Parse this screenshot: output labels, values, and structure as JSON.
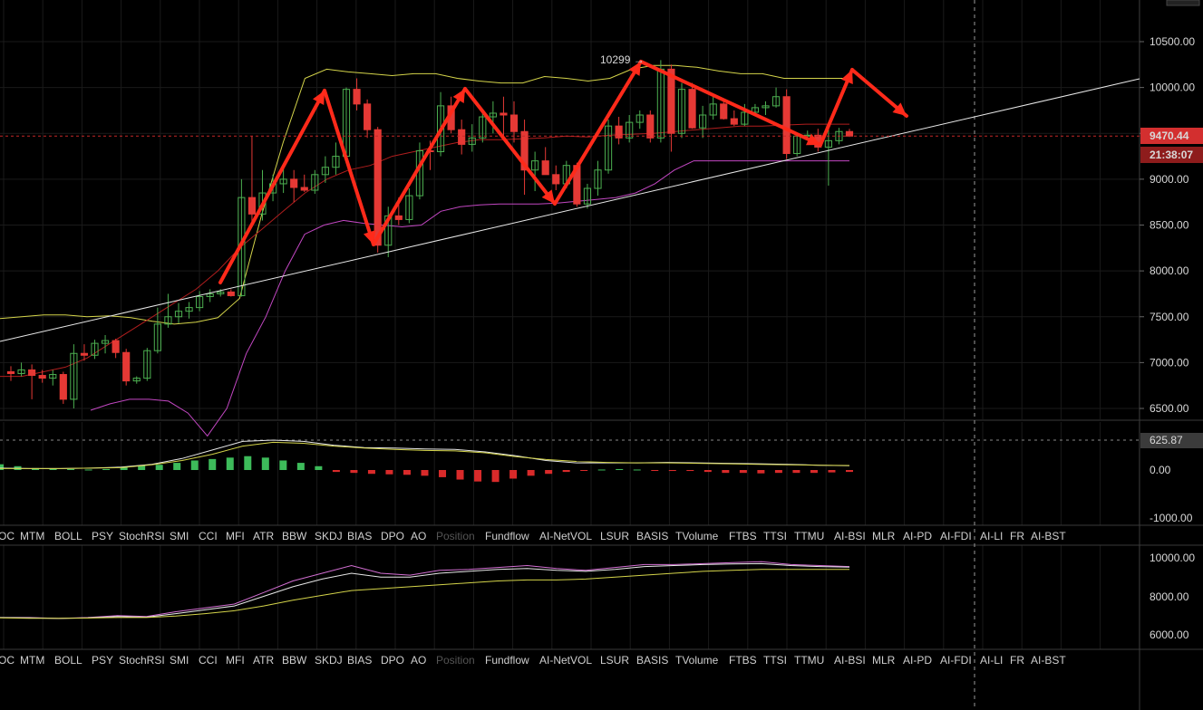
{
  "price_panel": {
    "y_ticks": [
      "10500.00",
      "10000.00",
      "9500.00",
      "9000.00",
      "8500.00",
      "8000.00",
      "7500.00",
      "7000.00",
      "6500.00"
    ],
    "price_label": "9470.44",
    "countdown_label": "21:38:07",
    "high_annotation": "10299",
    "price_tag_color": "#d32f2f",
    "up_candle_color": "#4caf50",
    "down_candle_color": "#e53935"
  },
  "macd_panel": {
    "y_ticks": [
      "625.87",
      "0.00",
      "-1000.00"
    ]
  },
  "lower_panel": {
    "y_ticks": [
      "10000.00",
      "8000.00",
      "6000.00"
    ]
  },
  "indicator_tabs": [
    {
      "label": "OC",
      "active": true
    },
    {
      "label": "MTM",
      "active": true
    },
    {
      "label": "BOLL",
      "active": true
    },
    {
      "label": "PSY",
      "active": true
    },
    {
      "label": "StochRSI",
      "active": true
    },
    {
      "label": "SMI",
      "active": true
    },
    {
      "label": "CCI",
      "active": true
    },
    {
      "label": "MFI",
      "active": true
    },
    {
      "label": "ATR",
      "active": true
    },
    {
      "label": "BBW",
      "active": true
    },
    {
      "label": "SKDJ",
      "active": true
    },
    {
      "label": "BIAS",
      "active": true
    },
    {
      "label": "DPO",
      "active": true
    },
    {
      "label": "AO",
      "active": true
    },
    {
      "label": "Position",
      "active": false
    },
    {
      "label": "Fundflow",
      "active": true
    },
    {
      "label": "AI-NetVOL",
      "active": true
    },
    {
      "label": "LSUR",
      "active": true
    },
    {
      "label": "BASIS",
      "active": true
    },
    {
      "label": "TVolume",
      "active": true
    },
    {
      "label": "FTBS",
      "active": true
    },
    {
      "label": "TTSI",
      "active": true
    },
    {
      "label": "TTMU",
      "active": true
    },
    {
      "label": "AI-BSI",
      "active": true
    },
    {
      "label": "MLR",
      "active": true
    },
    {
      "label": "AI-PD",
      "active": true
    },
    {
      "label": "AI-FDI",
      "active": true
    },
    {
      "label": "AI-LI",
      "active": true
    },
    {
      "label": "FR",
      "active": true
    },
    {
      "label": "AI-BST",
      "active": true
    }
  ],
  "chart_data": {
    "type": "candlestick",
    "title": "",
    "ylim": [
      6400,
      10800
    ],
    "current_price": 9470.44,
    "candles": [
      {
        "o": 6900,
        "h": 6960,
        "l": 6800,
        "c": 6880
      },
      {
        "o": 6880,
        "h": 7000,
        "l": 6850,
        "c": 6920
      },
      {
        "o": 6920,
        "h": 6980,
        "l": 6600,
        "c": 6860
      },
      {
        "o": 6860,
        "h": 6920,
        "l": 6780,
        "c": 6830
      },
      {
        "o": 6830,
        "h": 6920,
        "l": 6750,
        "c": 6870
      },
      {
        "o": 6870,
        "h": 6900,
        "l": 6550,
        "c": 6600
      },
      {
        "o": 6600,
        "h": 7200,
        "l": 6500,
        "c": 7100
      },
      {
        "o": 7100,
        "h": 7200,
        "l": 7020,
        "c": 7080
      },
      {
        "o": 7080,
        "h": 7250,
        "l": 7040,
        "c": 7210
      },
      {
        "o": 7210,
        "h": 7300,
        "l": 7100,
        "c": 7240
      },
      {
        "o": 7240,
        "h": 7260,
        "l": 7050,
        "c": 7110
      },
      {
        "o": 7110,
        "h": 7150,
        "l": 6750,
        "c": 6800
      },
      {
        "o": 6800,
        "h": 6850,
        "l": 6770,
        "c": 6830
      },
      {
        "o": 6830,
        "h": 7160,
        "l": 6800,
        "c": 7130
      },
      {
        "o": 7130,
        "h": 7600,
        "l": 7100,
        "c": 7420
      },
      {
        "o": 7420,
        "h": 7750,
        "l": 7380,
        "c": 7500
      },
      {
        "o": 7500,
        "h": 7650,
        "l": 7430,
        "c": 7560
      },
      {
        "o": 7560,
        "h": 7660,
        "l": 7480,
        "c": 7600
      },
      {
        "o": 7600,
        "h": 7780,
        "l": 7560,
        "c": 7720
      },
      {
        "o": 7720,
        "h": 7800,
        "l": 7660,
        "c": 7750
      },
      {
        "o": 7750,
        "h": 7800,
        "l": 7720,
        "c": 7770
      },
      {
        "o": 7770,
        "h": 7800,
        "l": 7720,
        "c": 7730
      },
      {
        "o": 7730,
        "h": 9000,
        "l": 7720,
        "c": 8800
      },
      {
        "o": 8800,
        "h": 9470,
        "l": 8500,
        "c": 8620
      },
      {
        "o": 8620,
        "h": 9100,
        "l": 8550,
        "c": 8850
      },
      {
        "o": 8850,
        "h": 9050,
        "l": 8760,
        "c": 8950
      },
      {
        "o": 8950,
        "h": 9150,
        "l": 8850,
        "c": 9000
      },
      {
        "o": 9000,
        "h": 9100,
        "l": 8750,
        "c": 8910
      },
      {
        "o": 8910,
        "h": 9050,
        "l": 8860,
        "c": 8880
      },
      {
        "o": 8880,
        "h": 9100,
        "l": 8840,
        "c": 9050
      },
      {
        "o": 9050,
        "h": 9250,
        "l": 8960,
        "c": 9130
      },
      {
        "o": 9130,
        "h": 9400,
        "l": 9050,
        "c": 9250
      },
      {
        "o": 9250,
        "h": 10000,
        "l": 9200,
        "c": 9980
      },
      {
        "o": 9980,
        "h": 10100,
        "l": 9750,
        "c": 9820
      },
      {
        "o": 9820,
        "h": 9870,
        "l": 9450,
        "c": 9540
      },
      {
        "o": 9540,
        "h": 9570,
        "l": 8200,
        "c": 8280
      },
      {
        "o": 8280,
        "h": 8700,
        "l": 8150,
        "c": 8600
      },
      {
        "o": 8600,
        "h": 8800,
        "l": 8500,
        "c": 8560
      },
      {
        "o": 8560,
        "h": 8900,
        "l": 8520,
        "c": 8820
      },
      {
        "o": 8820,
        "h": 9400,
        "l": 8780,
        "c": 9310
      },
      {
        "o": 9310,
        "h": 9420,
        "l": 9100,
        "c": 9300
      },
      {
        "o": 9300,
        "h": 9950,
        "l": 9250,
        "c": 9800
      },
      {
        "o": 9800,
        "h": 9900,
        "l": 9500,
        "c": 9540
      },
      {
        "o": 9540,
        "h": 9650,
        "l": 9270,
        "c": 9380
      },
      {
        "o": 9380,
        "h": 9600,
        "l": 9300,
        "c": 9450
      },
      {
        "o": 9450,
        "h": 9750,
        "l": 9400,
        "c": 9680
      },
      {
        "o": 9680,
        "h": 9850,
        "l": 9500,
        "c": 9720
      },
      {
        "o": 9720,
        "h": 9900,
        "l": 9450,
        "c": 9700
      },
      {
        "o": 9700,
        "h": 9850,
        "l": 9400,
        "c": 9520
      },
      {
        "o": 9520,
        "h": 9650,
        "l": 8830,
        "c": 9100
      },
      {
        "o": 9100,
        "h": 9300,
        "l": 8870,
        "c": 9200
      },
      {
        "o": 9200,
        "h": 9350,
        "l": 9050,
        "c": 9050
      },
      {
        "o": 9050,
        "h": 9150,
        "l": 8880,
        "c": 8950
      },
      {
        "o": 8950,
        "h": 9200,
        "l": 8900,
        "c": 9150
      },
      {
        "o": 9150,
        "h": 9180,
        "l": 8700,
        "c": 8730
      },
      {
        "o": 8730,
        "h": 8950,
        "l": 8680,
        "c": 8900
      },
      {
        "o": 8900,
        "h": 9200,
        "l": 8820,
        "c": 9100
      },
      {
        "o": 9100,
        "h": 9650,
        "l": 9060,
        "c": 9580
      },
      {
        "o": 9580,
        "h": 9680,
        "l": 9380,
        "c": 9450
      },
      {
        "o": 9450,
        "h": 9700,
        "l": 9400,
        "c": 9620
      },
      {
        "o": 9620,
        "h": 9750,
        "l": 9550,
        "c": 9700
      },
      {
        "o": 9700,
        "h": 9750,
        "l": 9400,
        "c": 9450
      },
      {
        "o": 9450,
        "h": 10299,
        "l": 9400,
        "c": 10200
      },
      {
        "o": 10200,
        "h": 10250,
        "l": 9300,
        "c": 9500
      },
      {
        "o": 9500,
        "h": 10050,
        "l": 9450,
        "c": 9980
      },
      {
        "o": 9980,
        "h": 10050,
        "l": 9550,
        "c": 9560
      },
      {
        "o": 9560,
        "h": 9800,
        "l": 9450,
        "c": 9700
      },
      {
        "o": 9700,
        "h": 9900,
        "l": 9650,
        "c": 9820
      },
      {
        "o": 9820,
        "h": 9860,
        "l": 9650,
        "c": 9660
      },
      {
        "o": 9660,
        "h": 9750,
        "l": 9580,
        "c": 9600
      },
      {
        "o": 9600,
        "h": 9820,
        "l": 9580,
        "c": 9730
      },
      {
        "o": 9730,
        "h": 9820,
        "l": 9690,
        "c": 9780
      },
      {
        "o": 9780,
        "h": 9850,
        "l": 9700,
        "c": 9800
      },
      {
        "o": 9800,
        "h": 10000,
        "l": 9780,
        "c": 9900
      },
      {
        "o": 9900,
        "h": 9980,
        "l": 9220,
        "c": 9280
      },
      {
        "o": 9280,
        "h": 9500,
        "l": 9250,
        "c": 9470
      },
      {
        "o": 9470,
        "h": 9530,
        "l": 9430,
        "c": 9480
      },
      {
        "o": 9480,
        "h": 9550,
        "l": 9300,
        "c": 9350
      },
      {
        "o": 9350,
        "h": 9600,
        "l": 8930,
        "c": 9420
      },
      {
        "o": 9420,
        "h": 9560,
        "l": 9380,
        "c": 9520
      },
      {
        "o": 9520,
        "h": 9550,
        "l": 9460,
        "c": 9470
      }
    ],
    "bollinger": {
      "upper": [
        7480,
        7500,
        7520,
        7520,
        7500,
        7510,
        7490,
        7450,
        7420,
        7440,
        7490,
        7700,
        8600,
        9400,
        10100,
        10200,
        10170,
        10150,
        10130,
        10150,
        10150,
        10100,
        10070,
        10050,
        10050,
        10120,
        10100,
        10070,
        10100,
        10200,
        10240,
        10240,
        10220,
        10180,
        10150,
        10150,
        10100,
        10100,
        10100,
        10100
      ],
      "mid": [
        6850,
        6850,
        6900,
        6950,
        7050,
        7200,
        7350,
        7500,
        7650,
        7800,
        8000,
        8250,
        8450,
        8650,
        8850,
        9000,
        9100,
        9150,
        9250,
        9300,
        9350,
        9400,
        9430,
        9430,
        9440,
        9450,
        9470,
        9460,
        9480,
        9490,
        9500,
        9520,
        9540,
        9560,
        9580,
        9580,
        9590,
        9600,
        9600,
        9600
      ],
      "lower": [
        6480,
        6550,
        6600,
        6600,
        6580,
        6450,
        6200,
        6500,
        7100,
        7500,
        8000,
        8400,
        8500,
        8550,
        8520,
        8500,
        8480,
        8500,
        8650,
        8700,
        8720,
        8730,
        8730,
        8730,
        8740,
        8760,
        8780,
        8800,
        8850,
        8950,
        9100,
        9200,
        9200,
        9200,
        9200,
        9200,
        9200,
        9200,
        9200,
        9200
      ]
    },
    "trendline_end_value": 10100,
    "macd_hist": [
      120,
      80,
      40,
      30,
      20,
      10,
      20,
      60,
      90,
      110,
      150,
      200,
      230,
      260,
      290,
      260,
      200,
      150,
      80,
      -40,
      -60,
      -80,
      -90,
      -100,
      -120,
      -150,
      -200,
      -240,
      -250,
      -180,
      -120,
      -80,
      -40,
      -10,
      10,
      20,
      10,
      -10,
      -20,
      -20,
      -40,
      -60,
      -60,
      -70,
      -60,
      -60,
      -60,
      -50,
      -40
    ],
    "dif_line": [
      40,
      30,
      30,
      40,
      60,
      120,
      240,
      420,
      600,
      625,
      600,
      520,
      470,
      460,
      440,
      430,
      380,
      300,
      200,
      150,
      150,
      150,
      160,
      150,
      140,
      130,
      120,
      100,
      90
    ],
    "dea_line": [
      30,
      30,
      30,
      40,
      50,
      110,
      200,
      330,
      500,
      580,
      560,
      500,
      460,
      430,
      410,
      400,
      360,
      280,
      220,
      180,
      160,
      150,
      150,
      140,
      130,
      120,
      110,
      100,
      95
    ],
    "lower_ma_fast": [
      6900,
      6900,
      6850,
      6900,
      7000,
      6950,
      7200,
      7400,
      7600,
      8200,
      8800,
      9200,
      9600,
      9200,
      9100,
      9350,
      9400,
      9500,
      9600,
      9450,
      9350,
      9500,
      9650,
      9650,
      9700,
      9750,
      9800,
      9650,
      9600,
      9550
    ],
    "lower_ma_mid": [
      6900,
      6880,
      6850,
      6880,
      6950,
      6920,
      7100,
      7300,
      7500,
      8000,
      8500,
      8900,
      9200,
      9000,
      9000,
      9200,
      9300,
      9400,
      9450,
      9350,
      9300,
      9400,
      9550,
      9600,
      9650,
      9680,
      9700,
      9600,
      9550,
      9520
    ],
    "lower_ma_slow": [
      6880,
      6860,
      6860,
      6870,
      6900,
      6900,
      6980,
      7100,
      7250,
      7500,
      7800,
      8050,
      8300,
      8400,
      8500,
      8600,
      8700,
      8800,
      8850,
      8850,
      8900,
      9000,
      9100,
      9200,
      9300,
      9350,
      9400,
      9400,
      9400,
      9400
    ]
  }
}
